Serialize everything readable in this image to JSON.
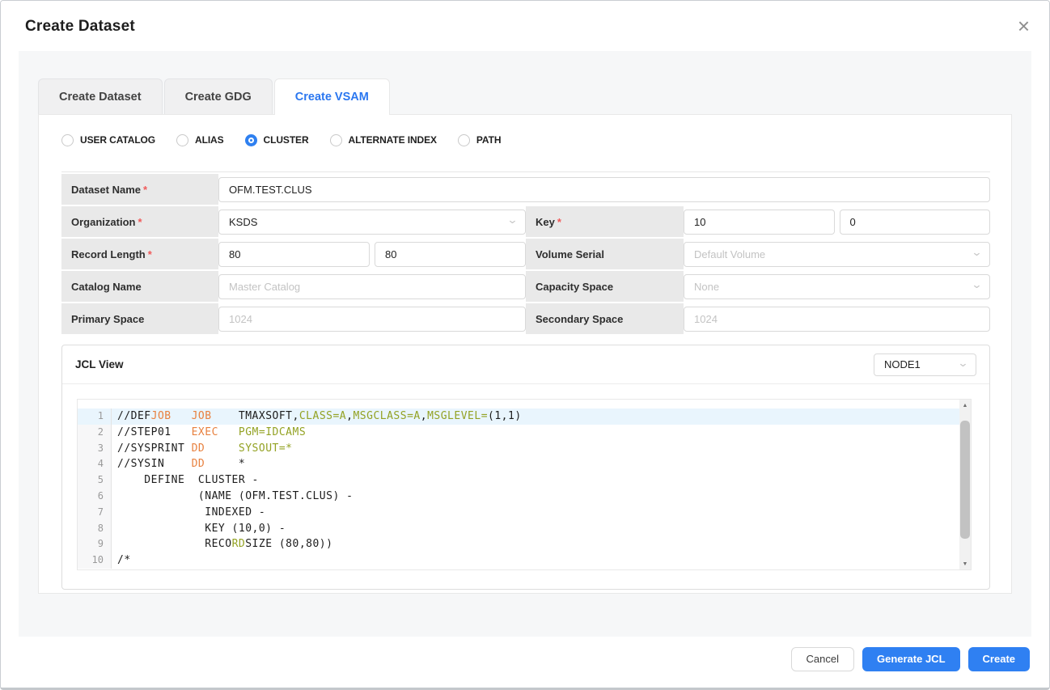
{
  "window": {
    "title": "Create Dataset",
    "close_icon": "×"
  },
  "tabs": [
    {
      "label": "Create Dataset",
      "active": false
    },
    {
      "label": "Create GDG",
      "active": false
    },
    {
      "label": "Create VSAM",
      "active": true
    }
  ],
  "radios": [
    {
      "label": "USER CATALOG",
      "selected": false
    },
    {
      "label": "ALIAS",
      "selected": false
    },
    {
      "label": "CLUSTER",
      "selected": true
    },
    {
      "label": "ALTERNATE INDEX",
      "selected": false
    },
    {
      "label": "PATH",
      "selected": false
    }
  ],
  "marks": {
    "required": "*"
  },
  "form": {
    "dataset_name": {
      "label": "Dataset Name",
      "value": "OFM.TEST.CLUS"
    },
    "organization": {
      "label": "Organization",
      "value": "KSDS"
    },
    "key": {
      "label": "Key",
      "value1": "10",
      "value2": "0"
    },
    "record_length": {
      "label": "Record Length",
      "value1": "80",
      "value2": "80"
    },
    "volume_serial": {
      "label": "Volume Serial",
      "placeholder": "Default Volume"
    },
    "catalog_name": {
      "label": "Catalog Name",
      "placeholder": "Master Catalog"
    },
    "capacity_space": {
      "label": "Capacity Space",
      "placeholder": "None"
    },
    "primary_space": {
      "label": "Primary Space",
      "placeholder": "1024"
    },
    "secondary_space": {
      "label": "Secondary Space",
      "placeholder": "1024"
    }
  },
  "jcl": {
    "title": "JCL View",
    "node_select": "NODE1",
    "lines": [
      {
        "num": "1",
        "highlight": true,
        "segments": [
          {
            "text": "//DEF",
            "color": "default"
          },
          {
            "text": "JOB",
            "color": "keyword"
          },
          {
            "text": "   ",
            "color": "default"
          },
          {
            "text": "JOB",
            "color": "keyword"
          },
          {
            "text": "    TMAXSOFT,",
            "color": "default"
          },
          {
            "text": "CLASS=A",
            "color": "param"
          },
          {
            "text": ",",
            "color": "default"
          },
          {
            "text": "MSGCLASS=A",
            "color": "param"
          },
          {
            "text": ",",
            "color": "default"
          },
          {
            "text": "MSGLEVEL=",
            "color": "param"
          },
          {
            "text": "(1,1)",
            "color": "default"
          }
        ]
      },
      {
        "num": "2",
        "highlight": false,
        "segments": [
          {
            "text": "//STEP01   ",
            "color": "default"
          },
          {
            "text": "EXEC",
            "color": "keyword"
          },
          {
            "text": "   ",
            "color": "default"
          },
          {
            "text": "PGM=IDCAMS",
            "color": "param"
          }
        ]
      },
      {
        "num": "3",
        "highlight": false,
        "segments": [
          {
            "text": "//SYSPRINT ",
            "color": "default"
          },
          {
            "text": "DD",
            "color": "keyword"
          },
          {
            "text": "     ",
            "color": "default"
          },
          {
            "text": "SYSOUT=*",
            "color": "param"
          }
        ]
      },
      {
        "num": "4",
        "highlight": false,
        "segments": [
          {
            "text": "//SYSIN    ",
            "color": "default"
          },
          {
            "text": "DD",
            "color": "keyword"
          },
          {
            "text": "     *",
            "color": "default"
          }
        ]
      },
      {
        "num": "5",
        "highlight": false,
        "segments": [
          {
            "text": "    DEFINE  CLUSTER -",
            "color": "default"
          }
        ]
      },
      {
        "num": "6",
        "highlight": false,
        "segments": [
          {
            "text": "            (NAME (OFM.TEST.CLUS) -",
            "color": "default"
          }
        ]
      },
      {
        "num": "7",
        "highlight": false,
        "segments": [
          {
            "text": "             INDEXED -",
            "color": "default"
          }
        ]
      },
      {
        "num": "8",
        "highlight": false,
        "segments": [
          {
            "text": "             KEY (10,0) -",
            "color": "default"
          }
        ]
      },
      {
        "num": "9",
        "highlight": false,
        "segments": [
          {
            "text": "             RECO",
            "color": "default"
          },
          {
            "text": "RD",
            "color": "param"
          },
          {
            "text": "SIZE (80,80))",
            "color": "default"
          }
        ]
      },
      {
        "num": "10",
        "highlight": false,
        "segments": [
          {
            "text": "/*",
            "color": "default"
          }
        ]
      }
    ]
  },
  "footer": {
    "cancel": "Cancel",
    "generate": "Generate JCL",
    "create": "Create"
  },
  "colors": {
    "accent": "#2f80f2",
    "keyword_orange": "#e8813f",
    "param_green": "#93a223",
    "required_red": "#f05a5a",
    "line_highlight": "#e9f5fd"
  }
}
